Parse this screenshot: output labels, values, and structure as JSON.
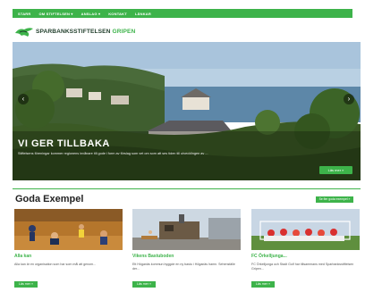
{
  "nav": {
    "items": [
      "STARR",
      "OM STIFTELSEN ▾",
      "ANSLAG ▾",
      "KONTAKT",
      "LÄNKAR"
    ]
  },
  "logo": {
    "part1": "SPARBANKSSTIFTELSEN",
    "part2": "GRIPEN"
  },
  "hero": {
    "title": "VI GER TILLBAKA",
    "text": "Stiftelsens föreningar kommer regionens invånare till gode i form av förslag som vet om som att ses tiden till utvecklingen av ...",
    "button_label": "Läs mer »",
    "prev_icon": "chevron-left-icon",
    "next_icon": "chevron-right-icon"
  },
  "section": {
    "title": "Goda Exempel",
    "button_label": "Se fler goda exempel »"
  },
  "cards": [
    {
      "title": "Alla kan",
      "text": "Alla kan är en organisation som har som mål att genom...",
      "button_label": "Läs mer »"
    },
    {
      "title": "Vikens Bastuboden",
      "text": "Ett Höganäs kommun byggde en ny bastu i Höganäs hamn. Sehenställe der...",
      "button_label": "Läs mer »"
    },
    {
      "title": "FC Örkelljunga...",
      "text": "FC Örkelljunga och Stadt Golf har tillsammans med Sparbanksstiftelsen Gripen...",
      "button_label": "Läs mer »"
    }
  ],
  "colors": {
    "brand_green": "#3db34a",
    "logo_dark": "#1f3d2a"
  }
}
